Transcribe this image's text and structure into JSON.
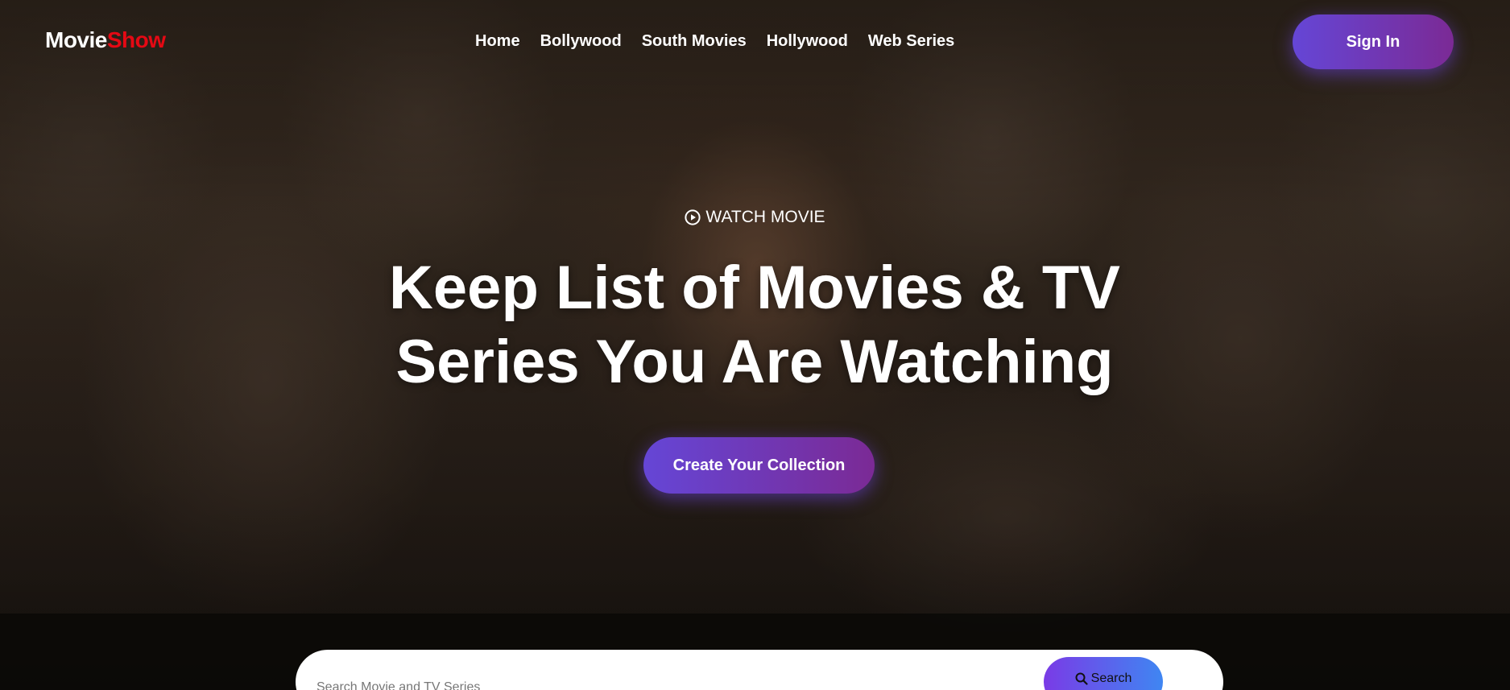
{
  "brand": {
    "name_part1": "Movie",
    "name_part2": "Show",
    "accent_color": "#e50914"
  },
  "nav": {
    "items": [
      {
        "label": "Home"
      },
      {
        "label": "Bollywood"
      },
      {
        "label": "South Movies"
      },
      {
        "label": "Hollywood"
      },
      {
        "label": "Web Series"
      }
    ]
  },
  "header": {
    "signin_label": "Sign In"
  },
  "hero": {
    "watch_icon": "play-circle-icon",
    "watch_label": "WATCH MOVIE",
    "headline_line1": "Keep List of Movies & TV",
    "headline_line2": "Series You Are Watching",
    "cta_label": "Create Your Collection"
  },
  "search": {
    "placeholder": "Search Movie and TV Series",
    "value": "",
    "button_icon": "search-icon",
    "button_label": "Search"
  },
  "colors": {
    "button_gradient_start": "#6546d6",
    "button_gradient_end": "#7b2a95",
    "search_gradient_start": "#7a3be6",
    "search_gradient_end": "#3f86f2"
  }
}
